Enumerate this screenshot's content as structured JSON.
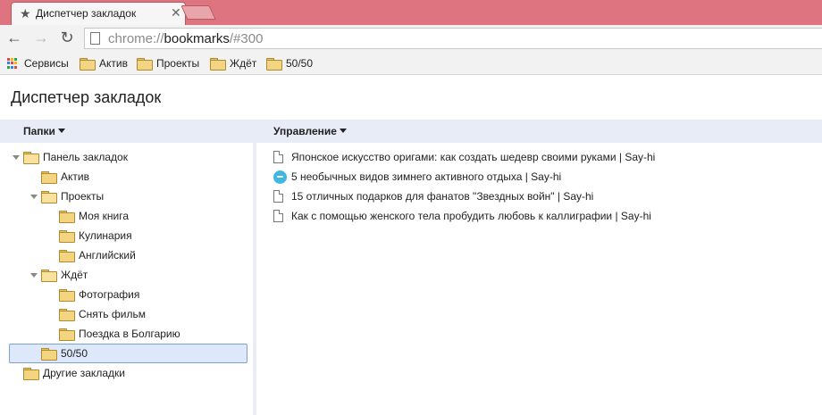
{
  "browser": {
    "tab_title": "Диспетчер закладок",
    "tab_star_icon": "★",
    "tab_close_icon": "✕",
    "back_icon": "←",
    "forward_icon": "→",
    "reload_icon": "↻",
    "url_scheme": "chrome://",
    "url_host": "bookmarks",
    "url_path": "/#300"
  },
  "bookmarks_bar": {
    "apps_label": "Сервисы",
    "items": [
      "Актив",
      "Проекты",
      "Ждёт",
      "50/50"
    ]
  },
  "page": {
    "title": "Диспетчер закладок",
    "folders_header": "Папки",
    "organize_header": "Управление"
  },
  "tree": [
    {
      "label": "Панель закладок"
    },
    {
      "label": "Актив"
    },
    {
      "label": "Проекты"
    },
    {
      "label": "Моя книга"
    },
    {
      "label": "Кулинария"
    },
    {
      "label": "Английский"
    },
    {
      "label": "Ждёт"
    },
    {
      "label": "Фотография"
    },
    {
      "label": "Снять фильм"
    },
    {
      "label": "Поездка в Болгарию"
    },
    {
      "label": "50/50"
    },
    {
      "label": "Другие закладки"
    }
  ],
  "bookmarks": [
    {
      "title": "Японское искусство оригами: как создать шедевр своими руками | Say-hi",
      "icon": "page-icon"
    },
    {
      "title": "5 необычных видов зимнего активного отдыха | Say-hi",
      "icon": "say-hi-favicon"
    },
    {
      "title": "15 отличных подарков для фанатов \"Звездных войн\" | Say-hi",
      "icon": "page-icon"
    },
    {
      "title": "Как с помощью женского тела пробудить любовь к каллиграфии | Say-hi",
      "icon": "page-icon"
    }
  ],
  "colors": {
    "titlebar": "#de7480",
    "header_band": "#e8ecf6",
    "selection": "#dde9fb"
  }
}
